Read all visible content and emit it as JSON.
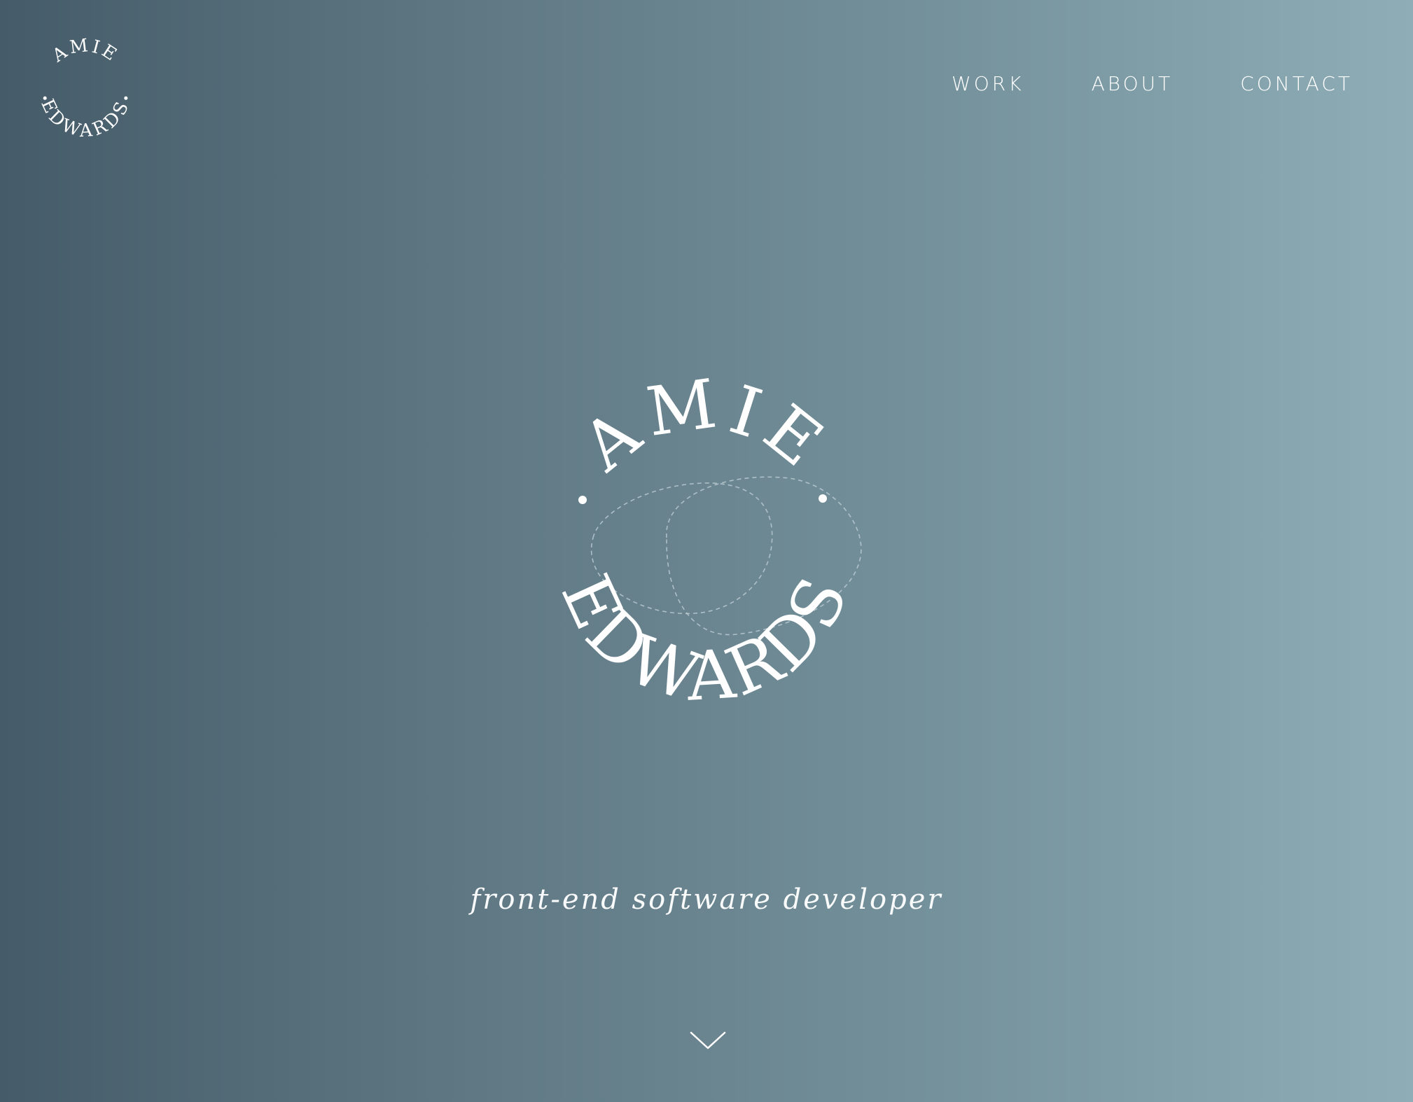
{
  "logo": {
    "text_top": "AMIE",
    "text_bottom": "EDWARDS",
    "separator": "•"
  },
  "nav": {
    "items": [
      {
        "label": "WORK"
      },
      {
        "label": "ABOUT"
      },
      {
        "label": "CONTACT"
      }
    ]
  },
  "hero": {
    "tagline": "front-end software developer"
  },
  "icons": {
    "scroll": "chevron-down-icon"
  },
  "colors": {
    "gradient_start": "#455b69",
    "gradient_end": "#8eadb6",
    "text": "#ffffff"
  }
}
